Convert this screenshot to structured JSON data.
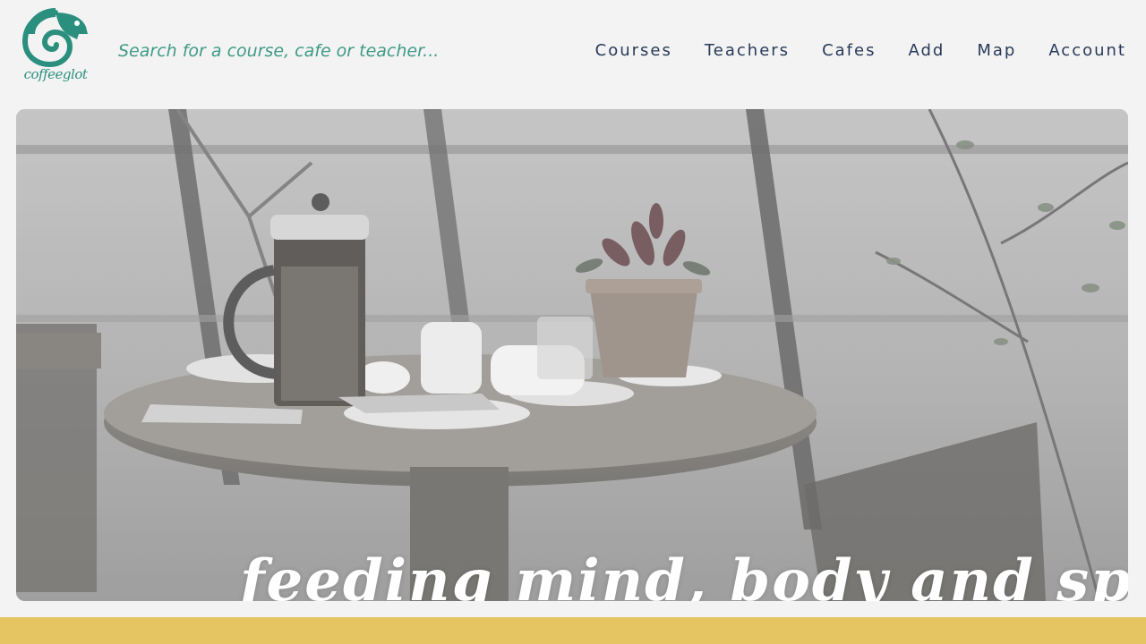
{
  "brand": {
    "name": "coffeeglot",
    "accent_color": "#2b8f7e"
  },
  "search": {
    "placeholder": "Search for a course, cafe or teacher..."
  },
  "nav": {
    "items": [
      {
        "label": "Courses"
      },
      {
        "label": "Teachers"
      },
      {
        "label": "Cafes"
      },
      {
        "label": "Add"
      },
      {
        "label": "Map"
      },
      {
        "label": "Account"
      }
    ]
  },
  "hero": {
    "tagline": "feeding mind, body and spirit",
    "image_description_icon": "cafe-table-photo"
  },
  "colors": {
    "background": "#f3f3f3",
    "nav_text": "#283a5a",
    "search_text": "#3f9a86",
    "footer_band": "#e5c462"
  }
}
